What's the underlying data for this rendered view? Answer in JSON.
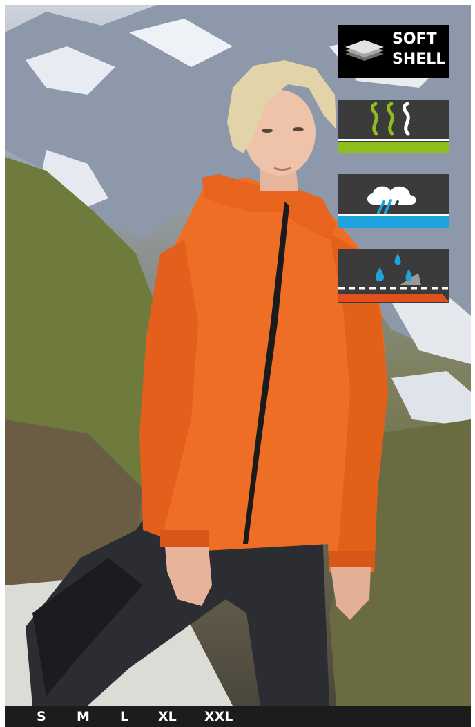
{
  "badges": {
    "softshell": {
      "line1": "SOFT",
      "line2": "SHELL",
      "icon": "layered-fabric-icon"
    },
    "breathable": {
      "icon": "breathable-vapor-icon",
      "accent": "#8fbc1f"
    },
    "rain": {
      "icon": "rain-cloud-icon",
      "accent": "#1ea3df"
    },
    "membrane": {
      "icon": "water-drops-membrane-icon",
      "accent": "#e2501c"
    }
  },
  "sizes": [
    "S",
    "M",
    "L",
    "XL",
    "XXL"
  ],
  "colors": {
    "jacket": "#ef6e26",
    "trousers": "#2b2d33",
    "badge_bg": "#3b3b3b",
    "size_bar": "#1c1c1c"
  }
}
